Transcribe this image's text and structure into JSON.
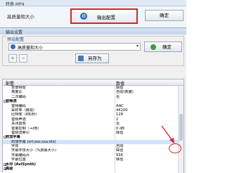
{
  "bg_window": {
    "title": "转换 MP4",
    "quality_label": "高质量和大小",
    "output_config_label": "输出配置",
    "ok_label": "确定"
  },
  "dialog": {
    "title": "输出设置",
    "preset_group_label": "预设配置",
    "preset_value": "高质量和大小",
    "confirm_label": "确定",
    "save_as_label": "另存为"
  },
  "grid": {
    "col_config": "配置",
    "col_value": "数值",
    "rows": [
      {
        "name": "背景特效",
        "value": "缺省",
        "type": "item"
      },
      {
        "name": "亮度比",
        "value": "自动(亮度)",
        "type": "item"
      },
      {
        "name": "二次编码",
        "value": "否",
        "type": "item"
      },
      {
        "name": "音频流",
        "value": "",
        "type": "section",
        "toggle": "-"
      },
      {
        "name": "音频编码",
        "value": "AAC",
        "type": "item"
      },
      {
        "name": "采样率（赫兹）",
        "value": "44100",
        "type": "item"
      },
      {
        "name": "比特率（KB/秒）",
        "value": "128",
        "type": "item"
      },
      {
        "name": "音频声道",
        "value": "2",
        "type": "item"
      },
      {
        "name": "关闭音效",
        "value": "否",
        "type": "item"
      },
      {
        "name": "音量控制（+dB）",
        "value": "0 dB",
        "type": "item"
      },
      {
        "name": "音频流索引",
        "value": "缺省",
        "type": "item"
      },
      {
        "name": "附加字幕",
        "value": "",
        "type": "section",
        "toggle": "-"
      },
      {
        "name": "附加字幕 (srt;ass;ssa;idx)",
        "value": "",
        "type": "item",
        "selected": true
      },
      {
        "name": "字体",
        "value": "自动",
        "type": "item"
      },
      {
        "name": "字幕字体大小（%屏幕大小）",
        "value": "缺省",
        "type": "item"
      },
      {
        "name": "字幕编码页",
        "value": "936",
        "type": "item"
      },
      {
        "name": "字幕位置",
        "value": "缺省",
        "type": "item"
      },
      {
        "name": "水印 (AviSynth)",
        "value": "",
        "type": "section",
        "toggle": "+"
      },
      {
        "name": "高级",
        "value": "",
        "type": "section",
        "toggle": "+"
      }
    ]
  },
  "colors": {
    "highlight_red": "#d9232d",
    "selection_blue": "#cfe3fa"
  }
}
